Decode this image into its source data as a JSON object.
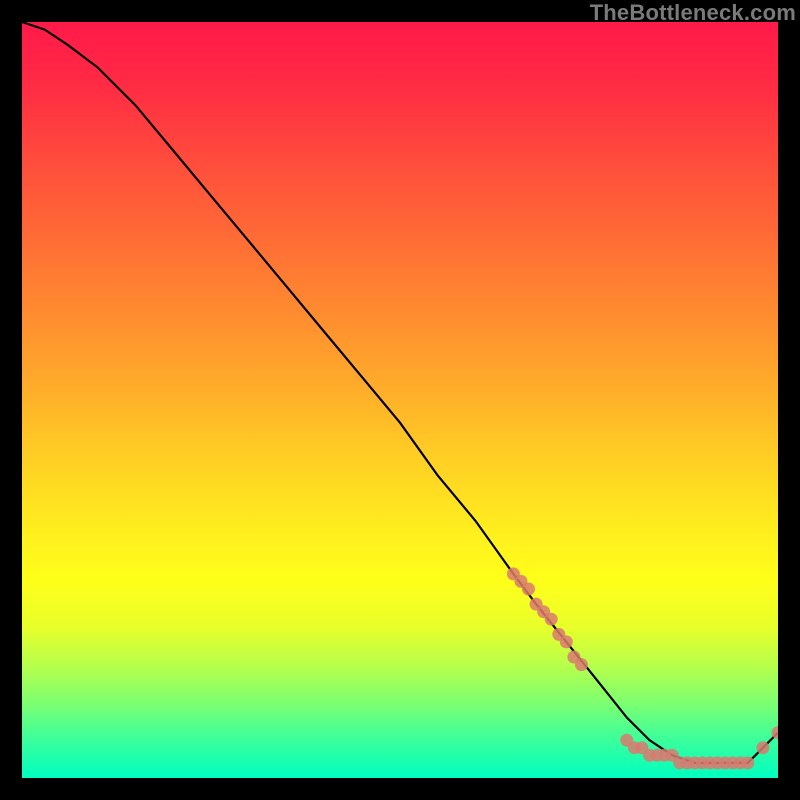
{
  "attribution": "TheBottleneck.com",
  "colors": {
    "marker": "#d97a6e",
    "curve": "#000000"
  },
  "chart_data": {
    "type": "line",
    "title": "",
    "xlabel": "",
    "ylabel": "",
    "xlim": [
      0,
      100
    ],
    "ylim": [
      0,
      100
    ],
    "grid": false,
    "legend": false,
    "series": [
      {
        "name": "bottleneck-curve",
        "x": [
          0,
          3,
          6,
          10,
          15,
          20,
          25,
          30,
          35,
          40,
          45,
          50,
          55,
          60,
          65,
          68,
          72,
          76,
          80,
          83,
          86,
          89,
          92,
          94,
          96,
          98,
          100
        ],
        "y": [
          100,
          99,
          97,
          94,
          89,
          83,
          77,
          71,
          65,
          59,
          53,
          47,
          40,
          34,
          27,
          23,
          18,
          13,
          8,
          5,
          3,
          2,
          2,
          2,
          2,
          4,
          6
        ]
      }
    ],
    "markers": [
      {
        "name": "cluster-mid",
        "x": [
          65,
          66,
          67,
          68,
          69,
          70,
          71,
          72,
          73,
          74
        ],
        "y": [
          27,
          26,
          25,
          23,
          22,
          21,
          19,
          18,
          16,
          15
        ]
      },
      {
        "name": "cluster-low",
        "x": [
          80,
          81,
          82,
          83,
          84,
          85,
          86,
          87,
          88,
          89,
          90,
          91,
          92,
          93,
          94,
          95,
          96
        ],
        "y": [
          5,
          4,
          4,
          3,
          3,
          3,
          3,
          2,
          2,
          2,
          2,
          2,
          2,
          2,
          2,
          2,
          2
        ]
      },
      {
        "name": "cluster-tail",
        "x": [
          98,
          100
        ],
        "y": [
          4,
          6
        ]
      }
    ]
  }
}
